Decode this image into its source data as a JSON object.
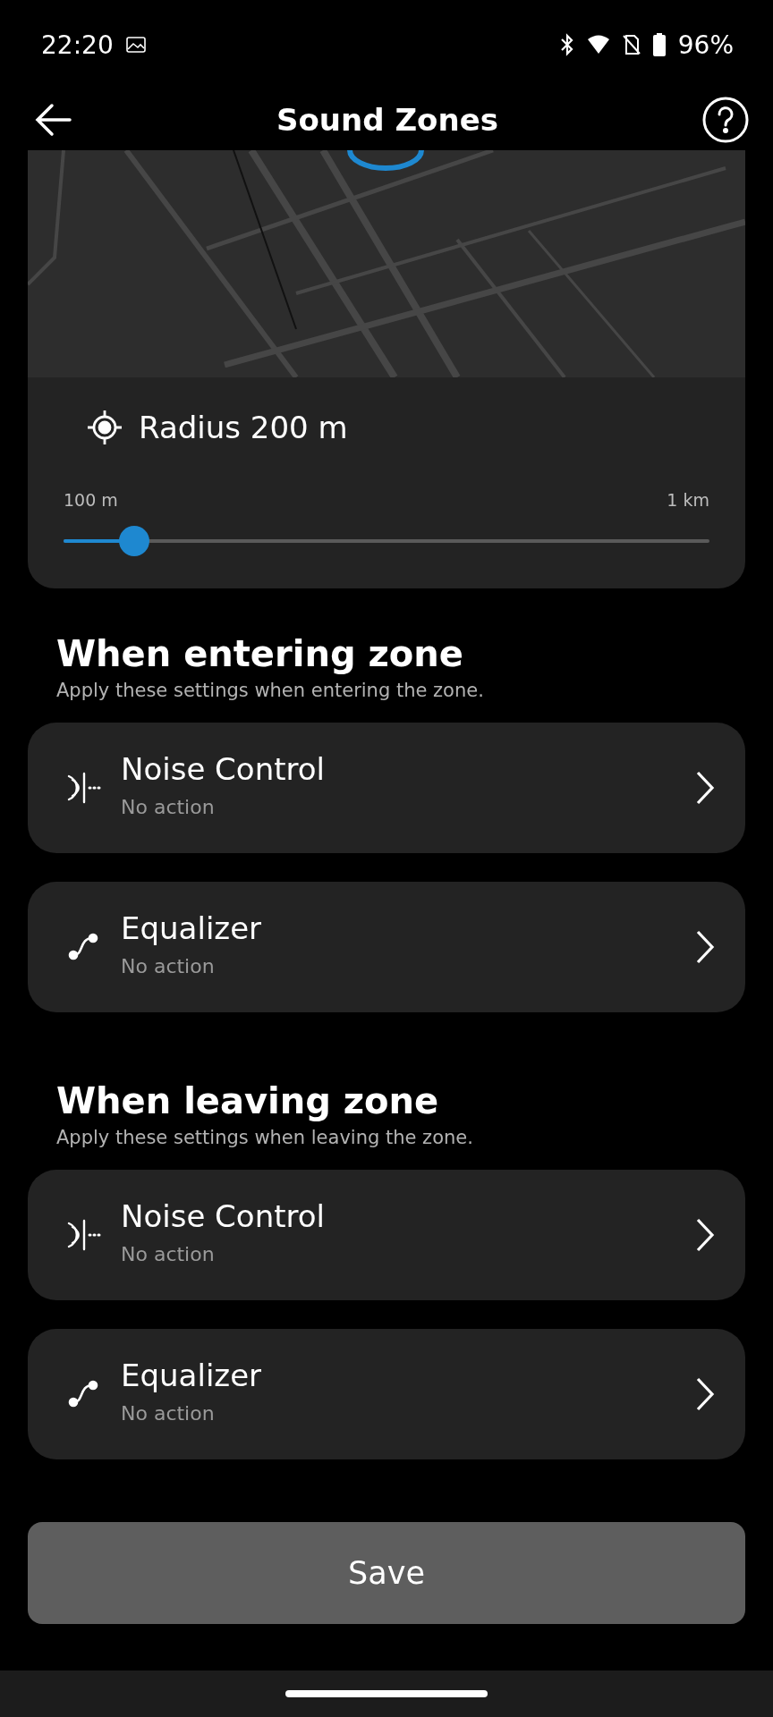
{
  "status_bar": {
    "time": "22:20",
    "battery": "96%"
  },
  "header": {
    "title": "Sound Zones"
  },
  "radius": {
    "label": "Radius 200 m",
    "min_label": "100 m",
    "max_label": "1 km",
    "level": 0.11
  },
  "sections": [
    {
      "title": "When entering zone",
      "subtitle": "Apply these settings when entering the zone.",
      "items": [
        {
          "kind": "noise",
          "title": "Noise Control",
          "value": "No action"
        },
        {
          "kind": "equalizer",
          "title": "Equalizer",
          "value": "No action"
        }
      ]
    },
    {
      "title": "When leaving zone",
      "subtitle": "Apply these settings when leaving the zone.",
      "items": [
        {
          "kind": "noise",
          "title": "Noise Control",
          "value": "No action"
        },
        {
          "kind": "equalizer",
          "title": "Equalizer",
          "value": "No action"
        }
      ]
    }
  ],
  "save_button": "Save"
}
